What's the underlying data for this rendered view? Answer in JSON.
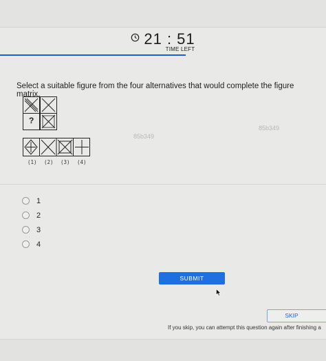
{
  "timer": {
    "value": "21 : 51",
    "label": "TIME LEFT"
  },
  "question": {
    "text": "Select a suitable figure from the four alternatives that would complete the figure matrix."
  },
  "matrix": {
    "missing_symbol": "?"
  },
  "alternatives": {
    "labels": [
      "(1)",
      "(2)",
      "(3)",
      "(4)"
    ]
  },
  "watermarks": [
    "85b349",
    "85b349"
  ],
  "options": [
    {
      "label": "1"
    },
    {
      "label": "2"
    },
    {
      "label": "3"
    },
    {
      "label": "4"
    }
  ],
  "actions": {
    "submit_label": "SUBMIT",
    "skip_label": "SKIP",
    "skip_note": "If you skip, you can attempt this question again after finishing a"
  },
  "colors": {
    "accent": "#1e6fe0",
    "progress": "#1d5fd0"
  },
  "icons": {
    "timer": "clock-icon",
    "cursor": "mouse-pointer-icon"
  }
}
